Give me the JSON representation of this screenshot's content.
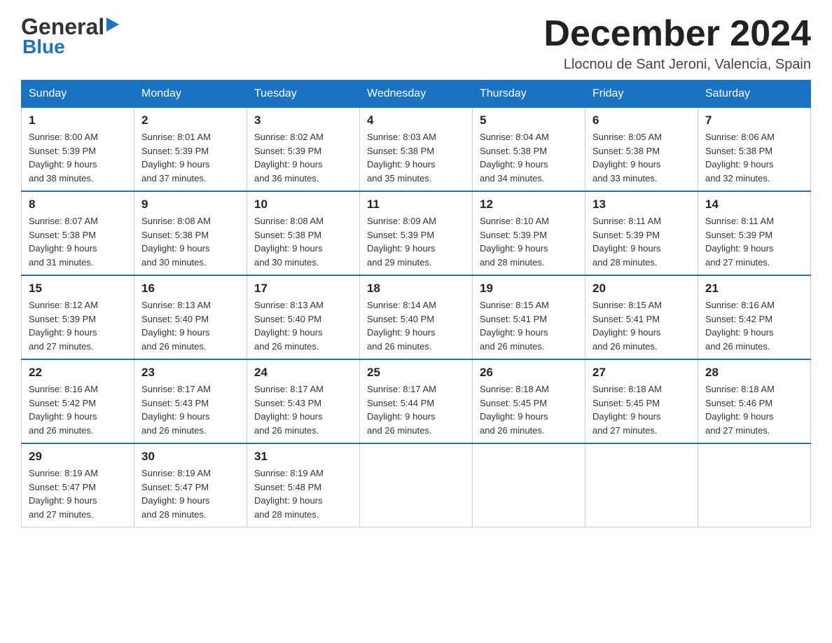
{
  "header": {
    "logo": {
      "line1": "General",
      "line2": "Blue"
    },
    "title": "December 2024",
    "location": "Llocnou de Sant Jeroni, Valencia, Spain"
  },
  "calendar": {
    "days_of_week": [
      "Sunday",
      "Monday",
      "Tuesday",
      "Wednesday",
      "Thursday",
      "Friday",
      "Saturday"
    ],
    "weeks": [
      [
        {
          "day": "1",
          "sunrise": "8:00 AM",
          "sunset": "5:39 PM",
          "daylight": "9 hours and 38 minutes."
        },
        {
          "day": "2",
          "sunrise": "8:01 AM",
          "sunset": "5:39 PM",
          "daylight": "9 hours and 37 minutes."
        },
        {
          "day": "3",
          "sunrise": "8:02 AM",
          "sunset": "5:39 PM",
          "daylight": "9 hours and 36 minutes."
        },
        {
          "day": "4",
          "sunrise": "8:03 AM",
          "sunset": "5:38 PM",
          "daylight": "9 hours and 35 minutes."
        },
        {
          "day": "5",
          "sunrise": "8:04 AM",
          "sunset": "5:38 PM",
          "daylight": "9 hours and 34 minutes."
        },
        {
          "day": "6",
          "sunrise": "8:05 AM",
          "sunset": "5:38 PM",
          "daylight": "9 hours and 33 minutes."
        },
        {
          "day": "7",
          "sunrise": "8:06 AM",
          "sunset": "5:38 PM",
          "daylight": "9 hours and 32 minutes."
        }
      ],
      [
        {
          "day": "8",
          "sunrise": "8:07 AM",
          "sunset": "5:38 PM",
          "daylight": "9 hours and 31 minutes."
        },
        {
          "day": "9",
          "sunrise": "8:08 AM",
          "sunset": "5:38 PM",
          "daylight": "9 hours and 30 minutes."
        },
        {
          "day": "10",
          "sunrise": "8:08 AM",
          "sunset": "5:38 PM",
          "daylight": "9 hours and 30 minutes."
        },
        {
          "day": "11",
          "sunrise": "8:09 AM",
          "sunset": "5:39 PM",
          "daylight": "9 hours and 29 minutes."
        },
        {
          "day": "12",
          "sunrise": "8:10 AM",
          "sunset": "5:39 PM",
          "daylight": "9 hours and 28 minutes."
        },
        {
          "day": "13",
          "sunrise": "8:11 AM",
          "sunset": "5:39 PM",
          "daylight": "9 hours and 28 minutes."
        },
        {
          "day": "14",
          "sunrise": "8:11 AM",
          "sunset": "5:39 PM",
          "daylight": "9 hours and 27 minutes."
        }
      ],
      [
        {
          "day": "15",
          "sunrise": "8:12 AM",
          "sunset": "5:39 PM",
          "daylight": "9 hours and 27 minutes."
        },
        {
          "day": "16",
          "sunrise": "8:13 AM",
          "sunset": "5:40 PM",
          "daylight": "9 hours and 26 minutes."
        },
        {
          "day": "17",
          "sunrise": "8:13 AM",
          "sunset": "5:40 PM",
          "daylight": "9 hours and 26 minutes."
        },
        {
          "day": "18",
          "sunrise": "8:14 AM",
          "sunset": "5:40 PM",
          "daylight": "9 hours and 26 minutes."
        },
        {
          "day": "19",
          "sunrise": "8:15 AM",
          "sunset": "5:41 PM",
          "daylight": "9 hours and 26 minutes."
        },
        {
          "day": "20",
          "sunrise": "8:15 AM",
          "sunset": "5:41 PM",
          "daylight": "9 hours and 26 minutes."
        },
        {
          "day": "21",
          "sunrise": "8:16 AM",
          "sunset": "5:42 PM",
          "daylight": "9 hours and 26 minutes."
        }
      ],
      [
        {
          "day": "22",
          "sunrise": "8:16 AM",
          "sunset": "5:42 PM",
          "daylight": "9 hours and 26 minutes."
        },
        {
          "day": "23",
          "sunrise": "8:17 AM",
          "sunset": "5:43 PM",
          "daylight": "9 hours and 26 minutes."
        },
        {
          "day": "24",
          "sunrise": "8:17 AM",
          "sunset": "5:43 PM",
          "daylight": "9 hours and 26 minutes."
        },
        {
          "day": "25",
          "sunrise": "8:17 AM",
          "sunset": "5:44 PM",
          "daylight": "9 hours and 26 minutes."
        },
        {
          "day": "26",
          "sunrise": "8:18 AM",
          "sunset": "5:45 PM",
          "daylight": "9 hours and 26 minutes."
        },
        {
          "day": "27",
          "sunrise": "8:18 AM",
          "sunset": "5:45 PM",
          "daylight": "9 hours and 27 minutes."
        },
        {
          "day": "28",
          "sunrise": "8:18 AM",
          "sunset": "5:46 PM",
          "daylight": "9 hours and 27 minutes."
        }
      ],
      [
        {
          "day": "29",
          "sunrise": "8:19 AM",
          "sunset": "5:47 PM",
          "daylight": "9 hours and 27 minutes."
        },
        {
          "day": "30",
          "sunrise": "8:19 AM",
          "sunset": "5:47 PM",
          "daylight": "9 hours and 28 minutes."
        },
        {
          "day": "31",
          "sunrise": "8:19 AM",
          "sunset": "5:48 PM",
          "daylight": "9 hours and 28 minutes."
        },
        null,
        null,
        null,
        null
      ]
    ]
  }
}
